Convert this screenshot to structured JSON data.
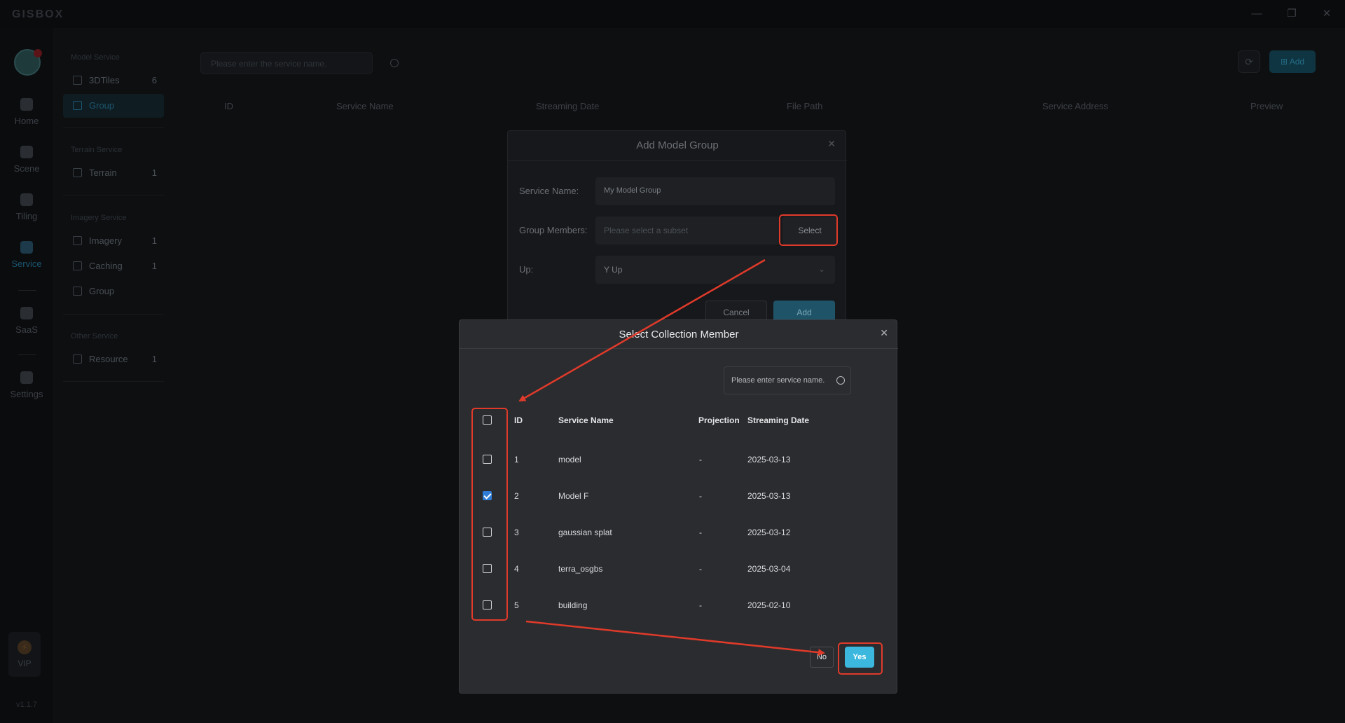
{
  "app": {
    "logo": "GISBOX",
    "version": "v1.1.7"
  },
  "window": {
    "minimize": "—",
    "restore": "❐",
    "close": "✕"
  },
  "rail": {
    "items": [
      {
        "label": "Home",
        "icon": "home-icon"
      },
      {
        "label": "Scene",
        "icon": "scene-icon"
      },
      {
        "label": "Tiling",
        "icon": "tiling-icon"
      },
      {
        "label": "Service",
        "icon": "service-icon"
      },
      {
        "label": "SaaS",
        "icon": "saas-icon"
      },
      {
        "label": "Settings",
        "icon": "settings-icon"
      }
    ],
    "vip": {
      "label": "VIP",
      "icon": "lightning-icon"
    }
  },
  "sidebar": {
    "sections": [
      {
        "title": "Model Service",
        "items": [
          {
            "label": "3DTiles",
            "count": "6"
          },
          {
            "label": "Group",
            "count": ""
          }
        ]
      },
      {
        "title": "Terrain Service",
        "items": [
          {
            "label": "Terrain",
            "count": "1"
          }
        ]
      },
      {
        "title": "Imagery Service",
        "items": [
          {
            "label": "Imagery",
            "count": "1"
          },
          {
            "label": "Caching",
            "count": "1"
          },
          {
            "label": "Group",
            "count": ""
          }
        ]
      },
      {
        "title": "Other Service",
        "items": [
          {
            "label": "Resource",
            "count": "1"
          }
        ]
      }
    ]
  },
  "main": {
    "search_placeholder": "Please enter the service name.",
    "add_label": "Add",
    "columns": [
      "ID",
      "Service Name",
      "Streaming Date",
      "File Path",
      "Service Address",
      "Preview"
    ]
  },
  "add_dialog": {
    "title": "Add Model Group",
    "service_name_label": "Service Name:",
    "service_name_value": "My Model Group",
    "group_members_label": "Group Members:",
    "group_members_placeholder": "Please select a subset",
    "select_label": "Select",
    "up_label": "Up:",
    "up_value": "Y Up",
    "cancel_label": "Cancel",
    "add_label": "Add"
  },
  "select_dialog": {
    "title": "Select Collection Member",
    "search_placeholder": "Please enter service name.",
    "columns": {
      "id": "ID",
      "service_name": "Service Name",
      "projection": "Projection",
      "streaming_date": "Streaming Date"
    },
    "rows": [
      {
        "id": "1",
        "service_name": "model",
        "projection": "-",
        "streaming_date": "2025-03-13",
        "checked": false
      },
      {
        "id": "2",
        "service_name": "Model F",
        "projection": "-",
        "streaming_date": "2025-03-13",
        "checked": true
      },
      {
        "id": "3",
        "service_name": "gaussian splat",
        "projection": "-",
        "streaming_date": "2025-03-12",
        "checked": false
      },
      {
        "id": "4",
        "service_name": "terra_osgbs",
        "projection": "-",
        "streaming_date": "2025-03-04",
        "checked": false
      },
      {
        "id": "5",
        "service_name": "building",
        "projection": "-",
        "streaming_date": "2025-02-10",
        "checked": false
      }
    ],
    "no_label": "No",
    "yes_label": "Yes"
  },
  "colors": {
    "accent": "#3cb8df",
    "annotation": "#e03a2a",
    "checkbox": "#2f7dd6"
  }
}
